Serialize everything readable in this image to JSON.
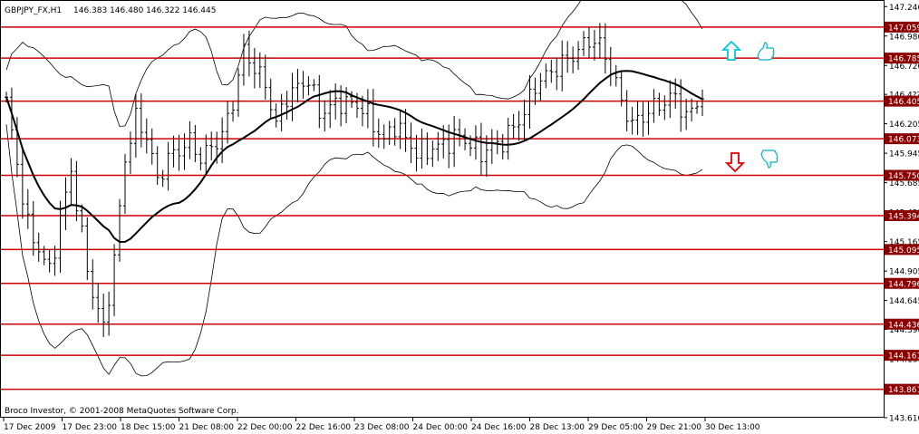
{
  "window": {
    "symbol_title": "GBPJPY_FX,H1",
    "ohlc_readout": "146.383 146.480 146.322 146.445",
    "copyright": "Broco Investor, © 2001-2008 MetaQuotes Software Corp."
  },
  "colors": {
    "level_line": "#cc0000",
    "level_label_bg": "#8b0000",
    "bar": "#000000",
    "up_arrow": "#00c8d8",
    "down_arrow": "#e00000",
    "thumbs_icon": "#00b0c8"
  },
  "icons": [
    "up-arrow-icon",
    "thumbs-up-icon",
    "down-arrow-icon",
    "thumbs-down-icon"
  ],
  "chart_data": {
    "type": "candlestick",
    "ylim": [
      143.61,
      147.29
    ],
    "y_ticks": [
      {
        "value": 147.24,
        "label": "147.240"
      },
      {
        "value": 146.98,
        "label": "146.980"
      },
      {
        "value": 146.72,
        "label": "146.720"
      },
      {
        "value": 146.465,
        "label": "146.4??"
      },
      {
        "value": 146.205,
        "label": "146.205"
      },
      {
        "value": 145.945,
        "label": "145.945"
      },
      {
        "value": 145.685,
        "label": "145.685"
      },
      {
        "value": 145.425,
        "label": "145.425"
      },
      {
        "value": 145.165,
        "label": "145.165"
      },
      {
        "value": 144.905,
        "label": "144.905"
      },
      {
        "value": 144.645,
        "label": "144.645"
      },
      {
        "value": 144.39,
        "label": "144.390"
      },
      {
        "value": 144.13,
        "label": "144.130"
      },
      {
        "value": 143.87,
        "label": "143.870"
      },
      {
        "value": 143.61,
        "label": "143.610"
      }
    ],
    "levels": [
      {
        "value": 147.059,
        "label": "147.059"
      },
      {
        "value": 146.785,
        "label": "146.785"
      },
      {
        "value": 146.405,
        "label": "146.405"
      },
      {
        "value": 146.073,
        "label": "146.073"
      },
      {
        "value": 145.75,
        "label": "145.750"
      },
      {
        "value": 145.394,
        "label": "145.394"
      },
      {
        "value": 145.095,
        "label": "145.095"
      },
      {
        "value": 144.796,
        "label": "144.796"
      },
      {
        "value": 144.436,
        "label": "144.436"
      },
      {
        "value": 144.161,
        "label": "144.161"
      },
      {
        "value": 143.861,
        "label": "143.861"
      }
    ],
    "x_labels": [
      "17 Dec 2009",
      "17 Dec 23:00",
      "18 Dec 15:00",
      "21 Dec 08:00",
      "22 Dec 00:00",
      "22 Dec 16:00",
      "23 Dec 08:00",
      "24 Dec 00:00",
      "24 Dec 16:00",
      "28 Dec 13:00",
      "29 Dec 05:00",
      "29 Dec 21:00",
      "30 Dec 13:00"
    ],
    "bar_count": 130,
    "price_path": [
      [
        0,
        146.4
      ],
      [
        4,
        145.3
      ],
      [
        8,
        144.9
      ],
      [
        12,
        145.8
      ],
      [
        14,
        145.2
      ],
      [
        16,
        144.7
      ],
      [
        18,
        144.4
      ],
      [
        20,
        145.0
      ],
      [
        22,
        145.9
      ],
      [
        24,
        146.25
      ],
      [
        26,
        146.1
      ],
      [
        28,
        145.7
      ],
      [
        30,
        145.9
      ],
      [
        34,
        146.05
      ],
      [
        36,
        145.9
      ],
      [
        40,
        146.1
      ],
      [
        42,
        146.4
      ],
      [
        44,
        146.85
      ],
      [
        48,
        146.55
      ],
      [
        50,
        146.2
      ],
      [
        52,
        146.45
      ],
      [
        56,
        146.6
      ],
      [
        58,
        146.3
      ],
      [
        62,
        146.4
      ],
      [
        66,
        146.35
      ],
      [
        70,
        146.05
      ],
      [
        72,
        146.2
      ],
      [
        76,
        145.95
      ],
      [
        80,
        146.0
      ],
      [
        84,
        146.1
      ],
      [
        88,
        145.95
      ],
      [
        92,
        146.05
      ],
      [
        96,
        146.3
      ],
      [
        98,
        146.55
      ],
      [
        102,
        146.7
      ],
      [
        106,
        146.85
      ],
      [
        108,
        146.95
      ],
      [
        110,
        146.9
      ],
      [
        112,
        146.7
      ],
      [
        114,
        146.4
      ],
      [
        116,
        146.2
      ],
      [
        120,
        146.35
      ],
      [
        124,
        146.45
      ],
      [
        126,
        146.25
      ],
      [
        128,
        146.4
      ],
      [
        129,
        146.445
      ]
    ]
  }
}
